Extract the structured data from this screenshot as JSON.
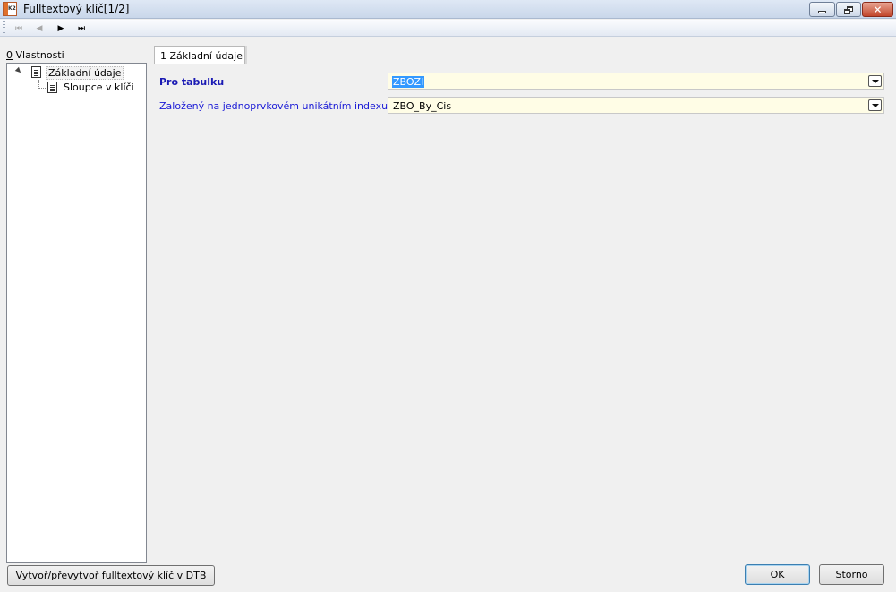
{
  "window": {
    "title": "Fulltextový klíč[1/2]",
    "app_icon": "K2",
    "controls": {
      "minimize": "minimize-icon",
      "restore": "restore-icon",
      "close": "✕"
    }
  },
  "navigation": {
    "first": "⏮",
    "prev": "◀",
    "next": "▶",
    "last": "⏭"
  },
  "properties_panel": {
    "label_accesskey": "0",
    "label_rest": " Vlastnosti",
    "tree": [
      {
        "label": "Základní údaje",
        "expanded": true,
        "selected": true
      },
      {
        "label": "Sloupce v klíči",
        "expanded": false,
        "selected": false
      }
    ]
  },
  "tab": {
    "label": "1 Základní údaje"
  },
  "form": {
    "table_label": "Pro tabulku",
    "table_value": "ZBOZI",
    "index_label": "Založený na jednoprvkovém unikátním indexu",
    "index_value": "ZBO_By_Cis"
  },
  "buttons": {
    "create": "Vytvoř/převytvoř fulltextový klíč v DTB",
    "ok": "OK",
    "cancel": "Storno"
  }
}
